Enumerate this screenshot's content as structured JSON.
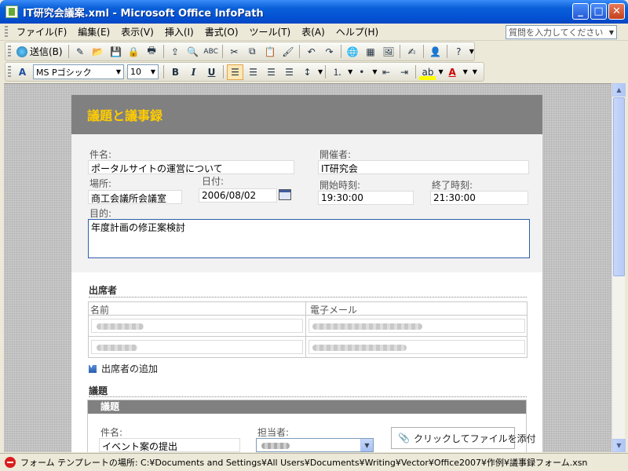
{
  "window": {
    "title": "IT研究会議案.xml - Microsoft Office InfoPath"
  },
  "menu": {
    "items": [
      "ファイル(F)",
      "編集(E)",
      "表示(V)",
      "挿入(I)",
      "書式(O)",
      "ツール(T)",
      "表(A)",
      "ヘルプ(H)"
    ],
    "help_placeholder": "質問を入力してください"
  },
  "toolbar1": {
    "send_label": "送信(B)"
  },
  "toolbar2": {
    "font": "MS Pゴシック",
    "size": "10",
    "bold": "B",
    "italic": "I",
    "underline": "U",
    "font_color_glyph": "A"
  },
  "form": {
    "title": "議題と議事録",
    "subject_label": "件名:",
    "subject_value": "ポータルサイトの運営について",
    "organizer_label": "開催者:",
    "organizer_value": "IT研究会",
    "location_label": "場所:",
    "location_value": "商工会議所会議室",
    "date_label": "日付:",
    "date_value": "2006/08/02",
    "start_label": "開始時刻:",
    "start_value": "19:30:00",
    "end_label": "終了時刻:",
    "end_value": "21:30:00",
    "purpose_label": "目的:",
    "purpose_value": "年度計画の修正案検討",
    "attendees": {
      "title": "出席者",
      "col_name": "名前",
      "col_email": "電子メール",
      "add_label": "出席者の追加"
    },
    "agenda": {
      "title": "議題",
      "block_title": "議題",
      "subject_label": "件名:",
      "subject_value": "イベント案の提出",
      "owner_label": "担当者:",
      "attach_label": "クリックしてファイルを添付"
    }
  },
  "status": {
    "text": "フォーム テンプレートの場所: C:¥Documents and Settings¥All Users¥Documents¥Writing¥Vector¥Office2007¥作例¥議事録フォーム.xsn"
  }
}
